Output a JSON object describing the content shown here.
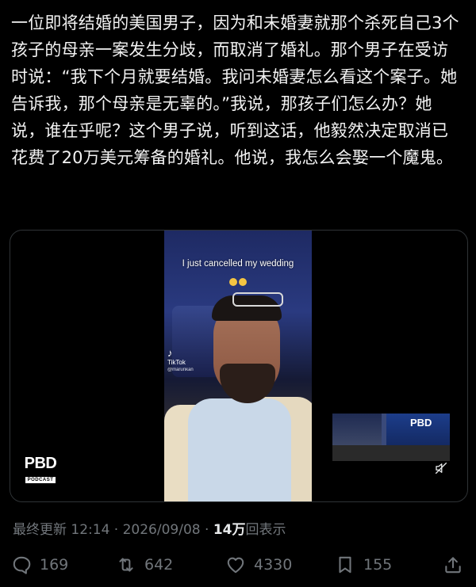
{
  "post": {
    "text": "一位即将结婚的美国男子，因为和未婚妻就那个杀死自己3个孩子的母亲一案发生分歧，而取消了婚礼。那个男子在受访时说：“我下个月就要结婚。我问未婚妻怎么看这个案子。她告诉我，那个母亲是无辜的。”我说，那孩子们怎么办？她说，谁在乎呢？这个男子说，听到这话，他毅然决定取消已花费了20万美元筹备的婚礼。他说，我怎么会娶一个魔鬼。"
  },
  "media": {
    "video_caption": "I just cancelled my wedding",
    "tiktok_logo": "♪",
    "tiktok_name": "TikTok",
    "tiktok_handle": "@marunkan",
    "pbd_logo_big": "PBD",
    "pbd_logo_small": "PODCAST",
    "thumb_pbd": "PBD"
  },
  "meta": {
    "prefix": "最终更新 12:14 · 2026/09/08 · ",
    "views": "14万",
    "views_label": "回表示"
  },
  "actions": {
    "replies": "169",
    "reposts": "642",
    "likes": "4330",
    "bookmarks": "155"
  },
  "colors": {
    "background": "#000000",
    "text": "#e7e9ea",
    "muted": "#71767b",
    "border": "#2f3336"
  }
}
